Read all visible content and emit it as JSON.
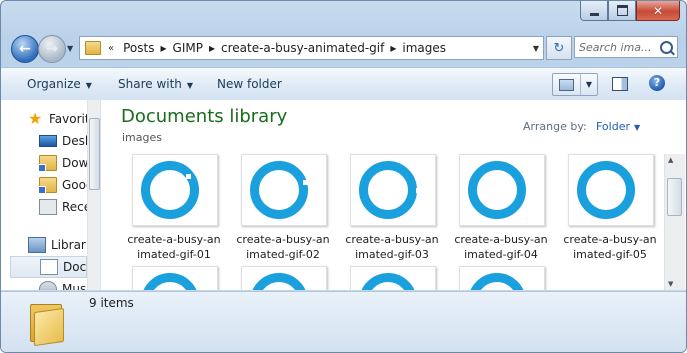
{
  "window": {
    "caption_buttons": {
      "minimize": "",
      "maximize": "",
      "close": "✕"
    }
  },
  "address_bar": {
    "overflow": "«",
    "crumbs": [
      "Posts",
      "GIMP",
      "create-a-busy-animated-gif",
      "images"
    ],
    "separator": "▸"
  },
  "search": {
    "placeholder": "Search ima..."
  },
  "command_bar": {
    "organize": "Organize",
    "share_with": "Share with",
    "new_folder": "New folder"
  },
  "nav_pane": {
    "items": [
      {
        "label": "Favorites",
        "icon": "star-icon"
      },
      {
        "label": "Desktop",
        "icon": "desktop-icon"
      },
      {
        "label": "Downloads",
        "icon": "folder-icon"
      },
      {
        "label": "Google Drive",
        "icon": "folder-icon"
      },
      {
        "label": "Recent Places",
        "icon": "recent-places-icon"
      },
      {
        "label": "Libraries",
        "icon": "library-icon"
      },
      {
        "label": "Documents",
        "icon": "documents-icon"
      },
      {
        "label": "Music",
        "icon": "music-icon"
      }
    ]
  },
  "library": {
    "title": "Documents library",
    "subtitle": "images",
    "arrange_label": "Arrange by:",
    "arrange_value": "Folder"
  },
  "files": [
    {
      "name_line1": "create-a-busy-an",
      "name_line2": "imated-gif-01",
      "accent": "#1aa0dd"
    },
    {
      "name_line1": "create-a-busy-an",
      "name_line2": "imated-gif-02",
      "accent": "#1aa0dd"
    },
    {
      "name_line1": "create-a-busy-an",
      "name_line2": "imated-gif-03",
      "accent": "#1aa0dd"
    },
    {
      "name_line1": "create-a-busy-an",
      "name_line2": "imated-gif-04",
      "accent": "#1aa0dd"
    },
    {
      "name_line1": "create-a-busy-an",
      "name_line2": "imated-gif-05",
      "accent": "#1aa0dd"
    },
    {
      "name_line1": "",
      "name_line2": "",
      "accent": "#1aa0dd"
    },
    {
      "name_line1": "",
      "name_line2": "",
      "accent": "#1aa0dd"
    },
    {
      "name_line1": "",
      "name_line2": "",
      "accent": "#1aa0dd"
    },
    {
      "name_line1": "",
      "name_line2": "",
      "accent": "#1aa0dd"
    }
  ],
  "details_pane": {
    "count": "9 items"
  },
  "colors": {
    "library_title": "#1a6b1a",
    "ring": "#1aa0dd",
    "link": "#1f5fb4"
  }
}
